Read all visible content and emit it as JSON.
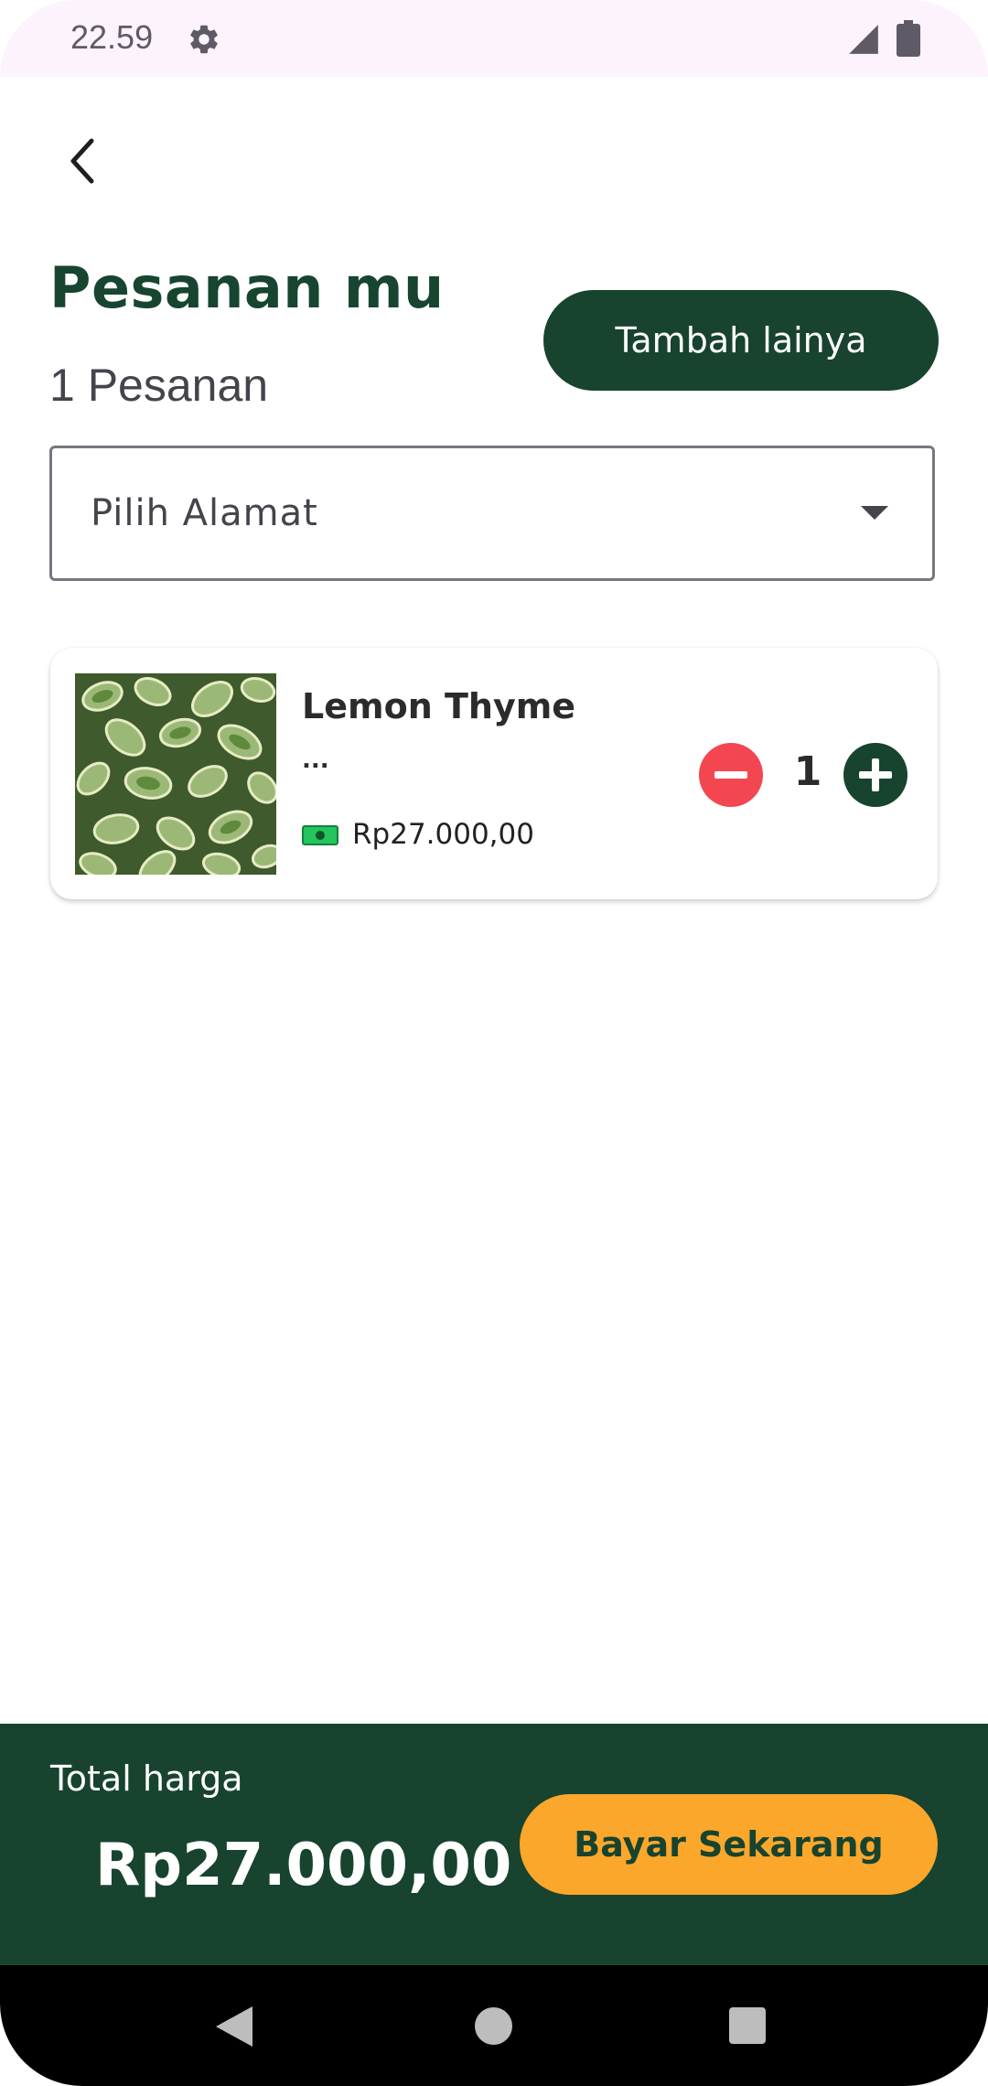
{
  "status_bar": {
    "time": "22.59"
  },
  "header": {
    "title": "Pesanan mu",
    "order_count": "1 Pesanan",
    "add_more_label": "Tambah lainya"
  },
  "address": {
    "placeholder": "Pilih Alamat"
  },
  "cart": {
    "items": [
      {
        "name": "Lemon Thyme",
        "description": "...",
        "price": "Rp27.000,00",
        "quantity": "1"
      }
    ]
  },
  "footer": {
    "total_label": "Total harga",
    "total_value": "Rp27.000,00",
    "pay_label": "Bayar Sekarang"
  },
  "colors": {
    "primary": "#17432f",
    "accent": "#fba72b",
    "danger": "#f34651",
    "money_icon": "#22c55e"
  },
  "icons": {
    "status": [
      "gear-icon",
      "signal-icon",
      "battery-icon"
    ],
    "back": "chevron-left-icon",
    "dropdown": "caret-down-icon",
    "price": "money-icon",
    "qty": [
      "minus-icon",
      "plus-icon"
    ],
    "nav": [
      "nav-back-icon",
      "nav-home-icon",
      "nav-recents-icon"
    ]
  }
}
